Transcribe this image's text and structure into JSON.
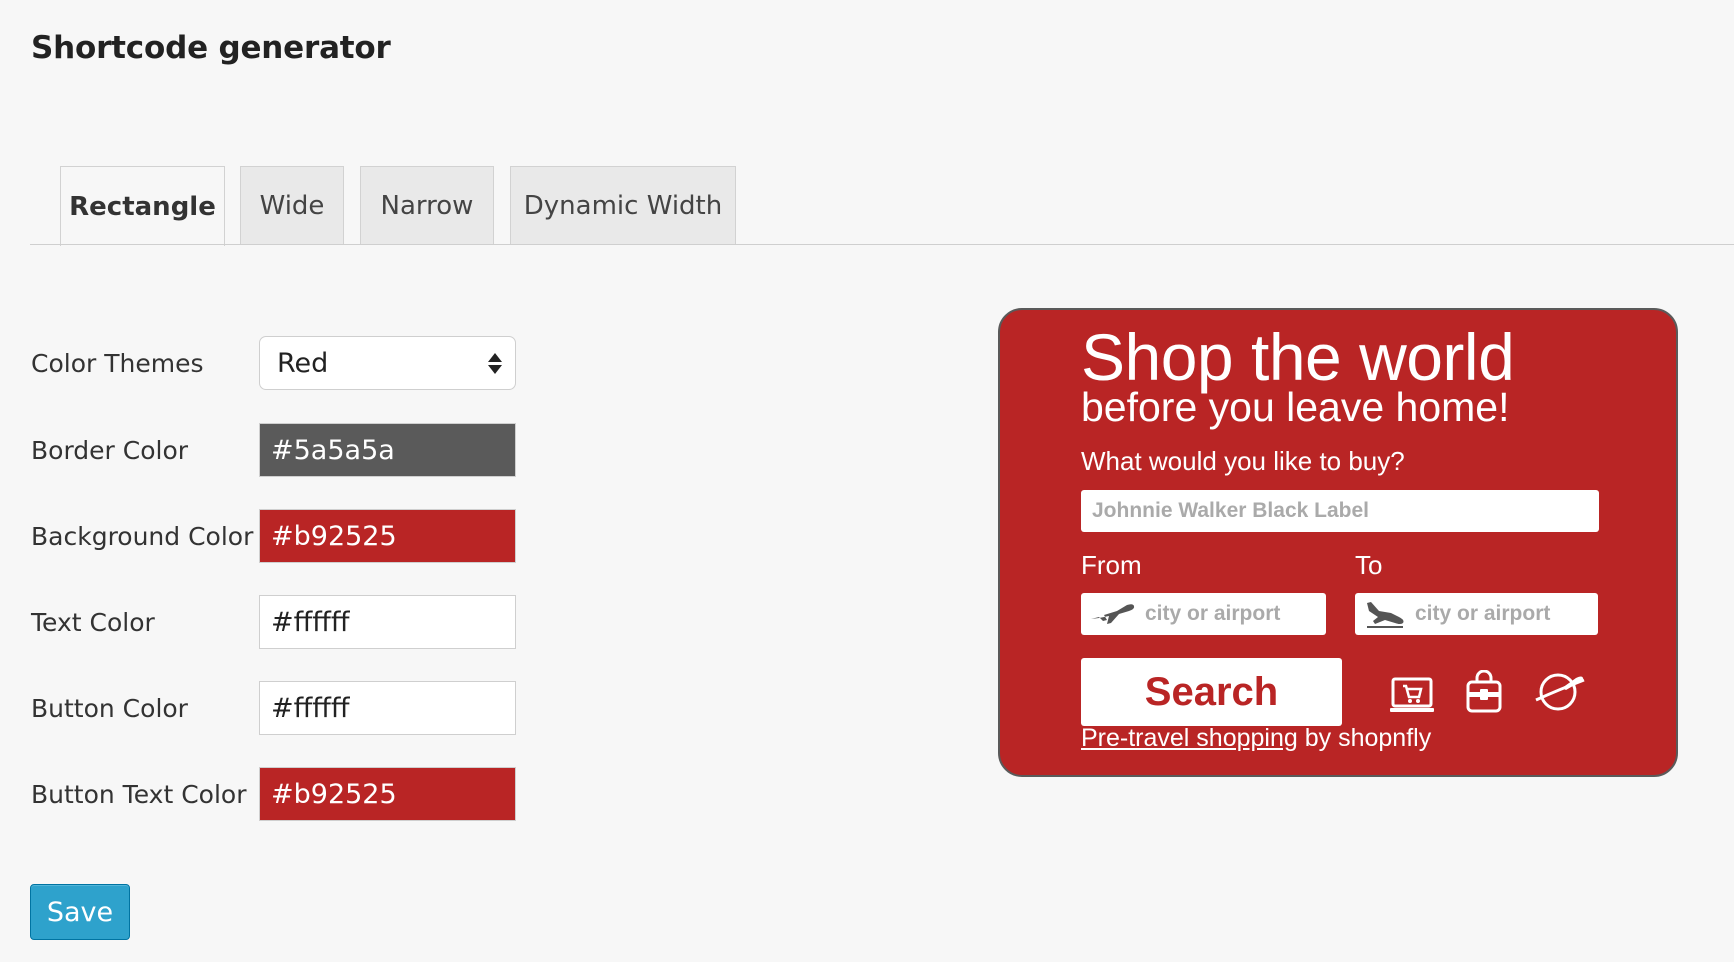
{
  "page": {
    "title": "Shortcode generator"
  },
  "tabs": [
    {
      "label": "Rectangle",
      "active": true
    },
    {
      "label": "Wide",
      "active": false
    },
    {
      "label": "Narrow",
      "active": false
    },
    {
      "label": "Dynamic Width",
      "active": false
    }
  ],
  "form": {
    "color_theme": {
      "label": "Color Themes",
      "value": "Red"
    },
    "border_color": {
      "label": "Border Color",
      "value": "#5a5a5a"
    },
    "background_color": {
      "label": "Background Color",
      "value": "#b92525"
    },
    "text_color": {
      "label": "Text Color",
      "value": "#ffffff"
    },
    "button_color": {
      "label": "Button Color",
      "value": "#ffffff"
    },
    "button_text_color": {
      "label": "Button Text Color",
      "value": "#b92525"
    },
    "save_label": "Save"
  },
  "preview": {
    "title": "Shop the world",
    "subtitle": "before you leave home!",
    "question": "What would you like to buy?",
    "product_placeholder": "Johnnie Walker Black Label",
    "from_label": "From",
    "to_label": "To",
    "from_placeholder": "city or airport",
    "to_placeholder": "city or airport",
    "search_label": "Search",
    "footer_link": "Pre-travel shopping",
    "footer_suffix": " by shopnfly",
    "icons": [
      "laptop-cart-icon",
      "shopping-bag-icon",
      "globe-plane-icon"
    ]
  },
  "colors": {
    "save_button": "#2ea2cc",
    "border_color_swatch": "#5a5a5a",
    "background_color_swatch": "#b92525",
    "text_color_swatch": "#ffffff",
    "button_color_swatch": "#ffffff",
    "button_text_color_swatch": "#b92525"
  }
}
